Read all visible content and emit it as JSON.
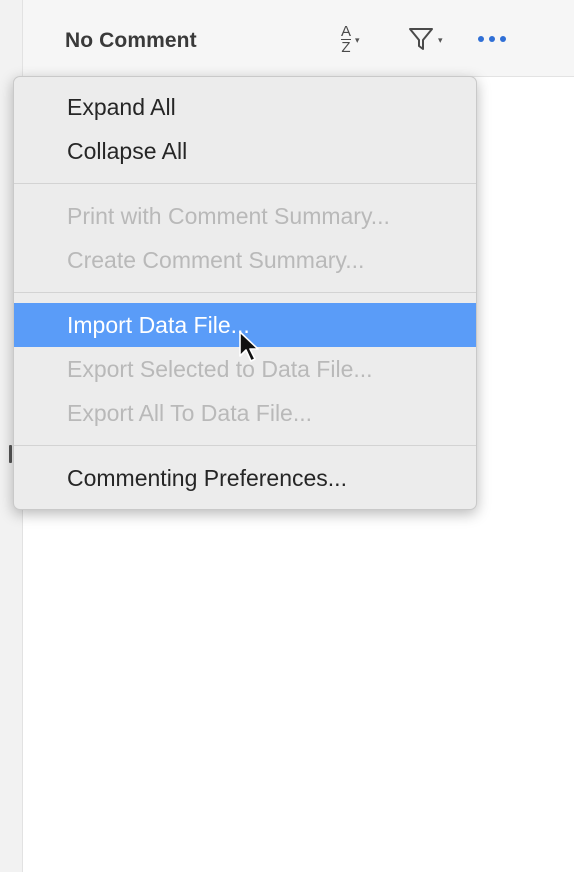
{
  "toolbar": {
    "title": "No Comment",
    "sort_icon_top": "A",
    "sort_icon_bottom": "Z",
    "caret": "▾",
    "icons": [
      "sort-az-icon",
      "filter-icon",
      "more-options-icon"
    ],
    "accent_color": "#2f6fd6"
  },
  "menu": {
    "items": [
      {
        "label": "Expand All",
        "enabled": true
      },
      {
        "label": "Collapse All",
        "enabled": true
      },
      {
        "label": "Print with Comment Summary...",
        "enabled": false
      },
      {
        "label": "Create Comment Summary...",
        "enabled": false
      },
      {
        "label": "Import Data File...",
        "enabled": true,
        "highlighted": true
      },
      {
        "label": "Export Selected to Data File...",
        "enabled": false
      },
      {
        "label": "Export All To Data File...",
        "enabled": false
      },
      {
        "label": "Commenting Preferences...",
        "enabled": true
      }
    ],
    "highlight_color": "#5a9cf8",
    "disabled_color": "#b9b9b9"
  }
}
